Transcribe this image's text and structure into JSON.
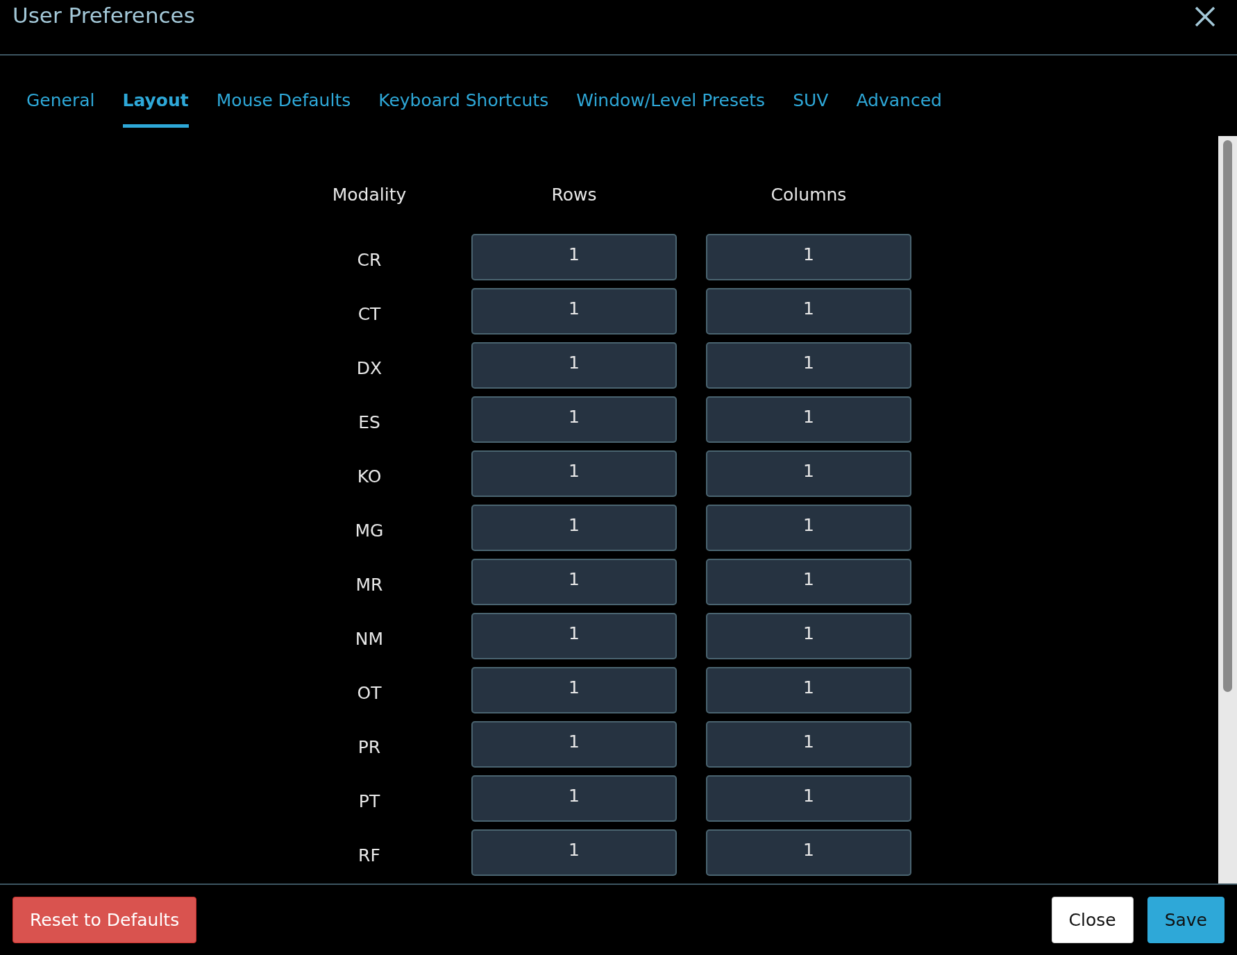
{
  "dialog": {
    "title": "User Preferences"
  },
  "tabs": [
    {
      "label": "General",
      "selected": false
    },
    {
      "label": "Layout",
      "selected": true
    },
    {
      "label": "Mouse Defaults",
      "selected": false
    },
    {
      "label": "Keyboard Shortcuts",
      "selected": false
    },
    {
      "label": "Window/Level Presets",
      "selected": false
    },
    {
      "label": "SUV",
      "selected": false
    },
    {
      "label": "Advanced",
      "selected": false
    }
  ],
  "table": {
    "columns": [
      "Modality",
      "Rows",
      "Columns"
    ],
    "rows": [
      {
        "modality": "CR",
        "rows": "1",
        "columns": "1"
      },
      {
        "modality": "CT",
        "rows": "1",
        "columns": "1"
      },
      {
        "modality": "DX",
        "rows": "1",
        "columns": "1"
      },
      {
        "modality": "ES",
        "rows": "1",
        "columns": "1"
      },
      {
        "modality": "KO",
        "rows": "1",
        "columns": "1"
      },
      {
        "modality": "MG",
        "rows": "1",
        "columns": "1"
      },
      {
        "modality": "MR",
        "rows": "1",
        "columns": "1"
      },
      {
        "modality": "NM",
        "rows": "1",
        "columns": "1"
      },
      {
        "modality": "OT",
        "rows": "1",
        "columns": "1"
      },
      {
        "modality": "PR",
        "rows": "1",
        "columns": "1"
      },
      {
        "modality": "PT",
        "rows": "1",
        "columns": "1"
      },
      {
        "modality": "RF",
        "rows": "1",
        "columns": "1"
      }
    ]
  },
  "footer": {
    "reset": "Reset to Defaults",
    "close": "Close",
    "save": "Save"
  }
}
